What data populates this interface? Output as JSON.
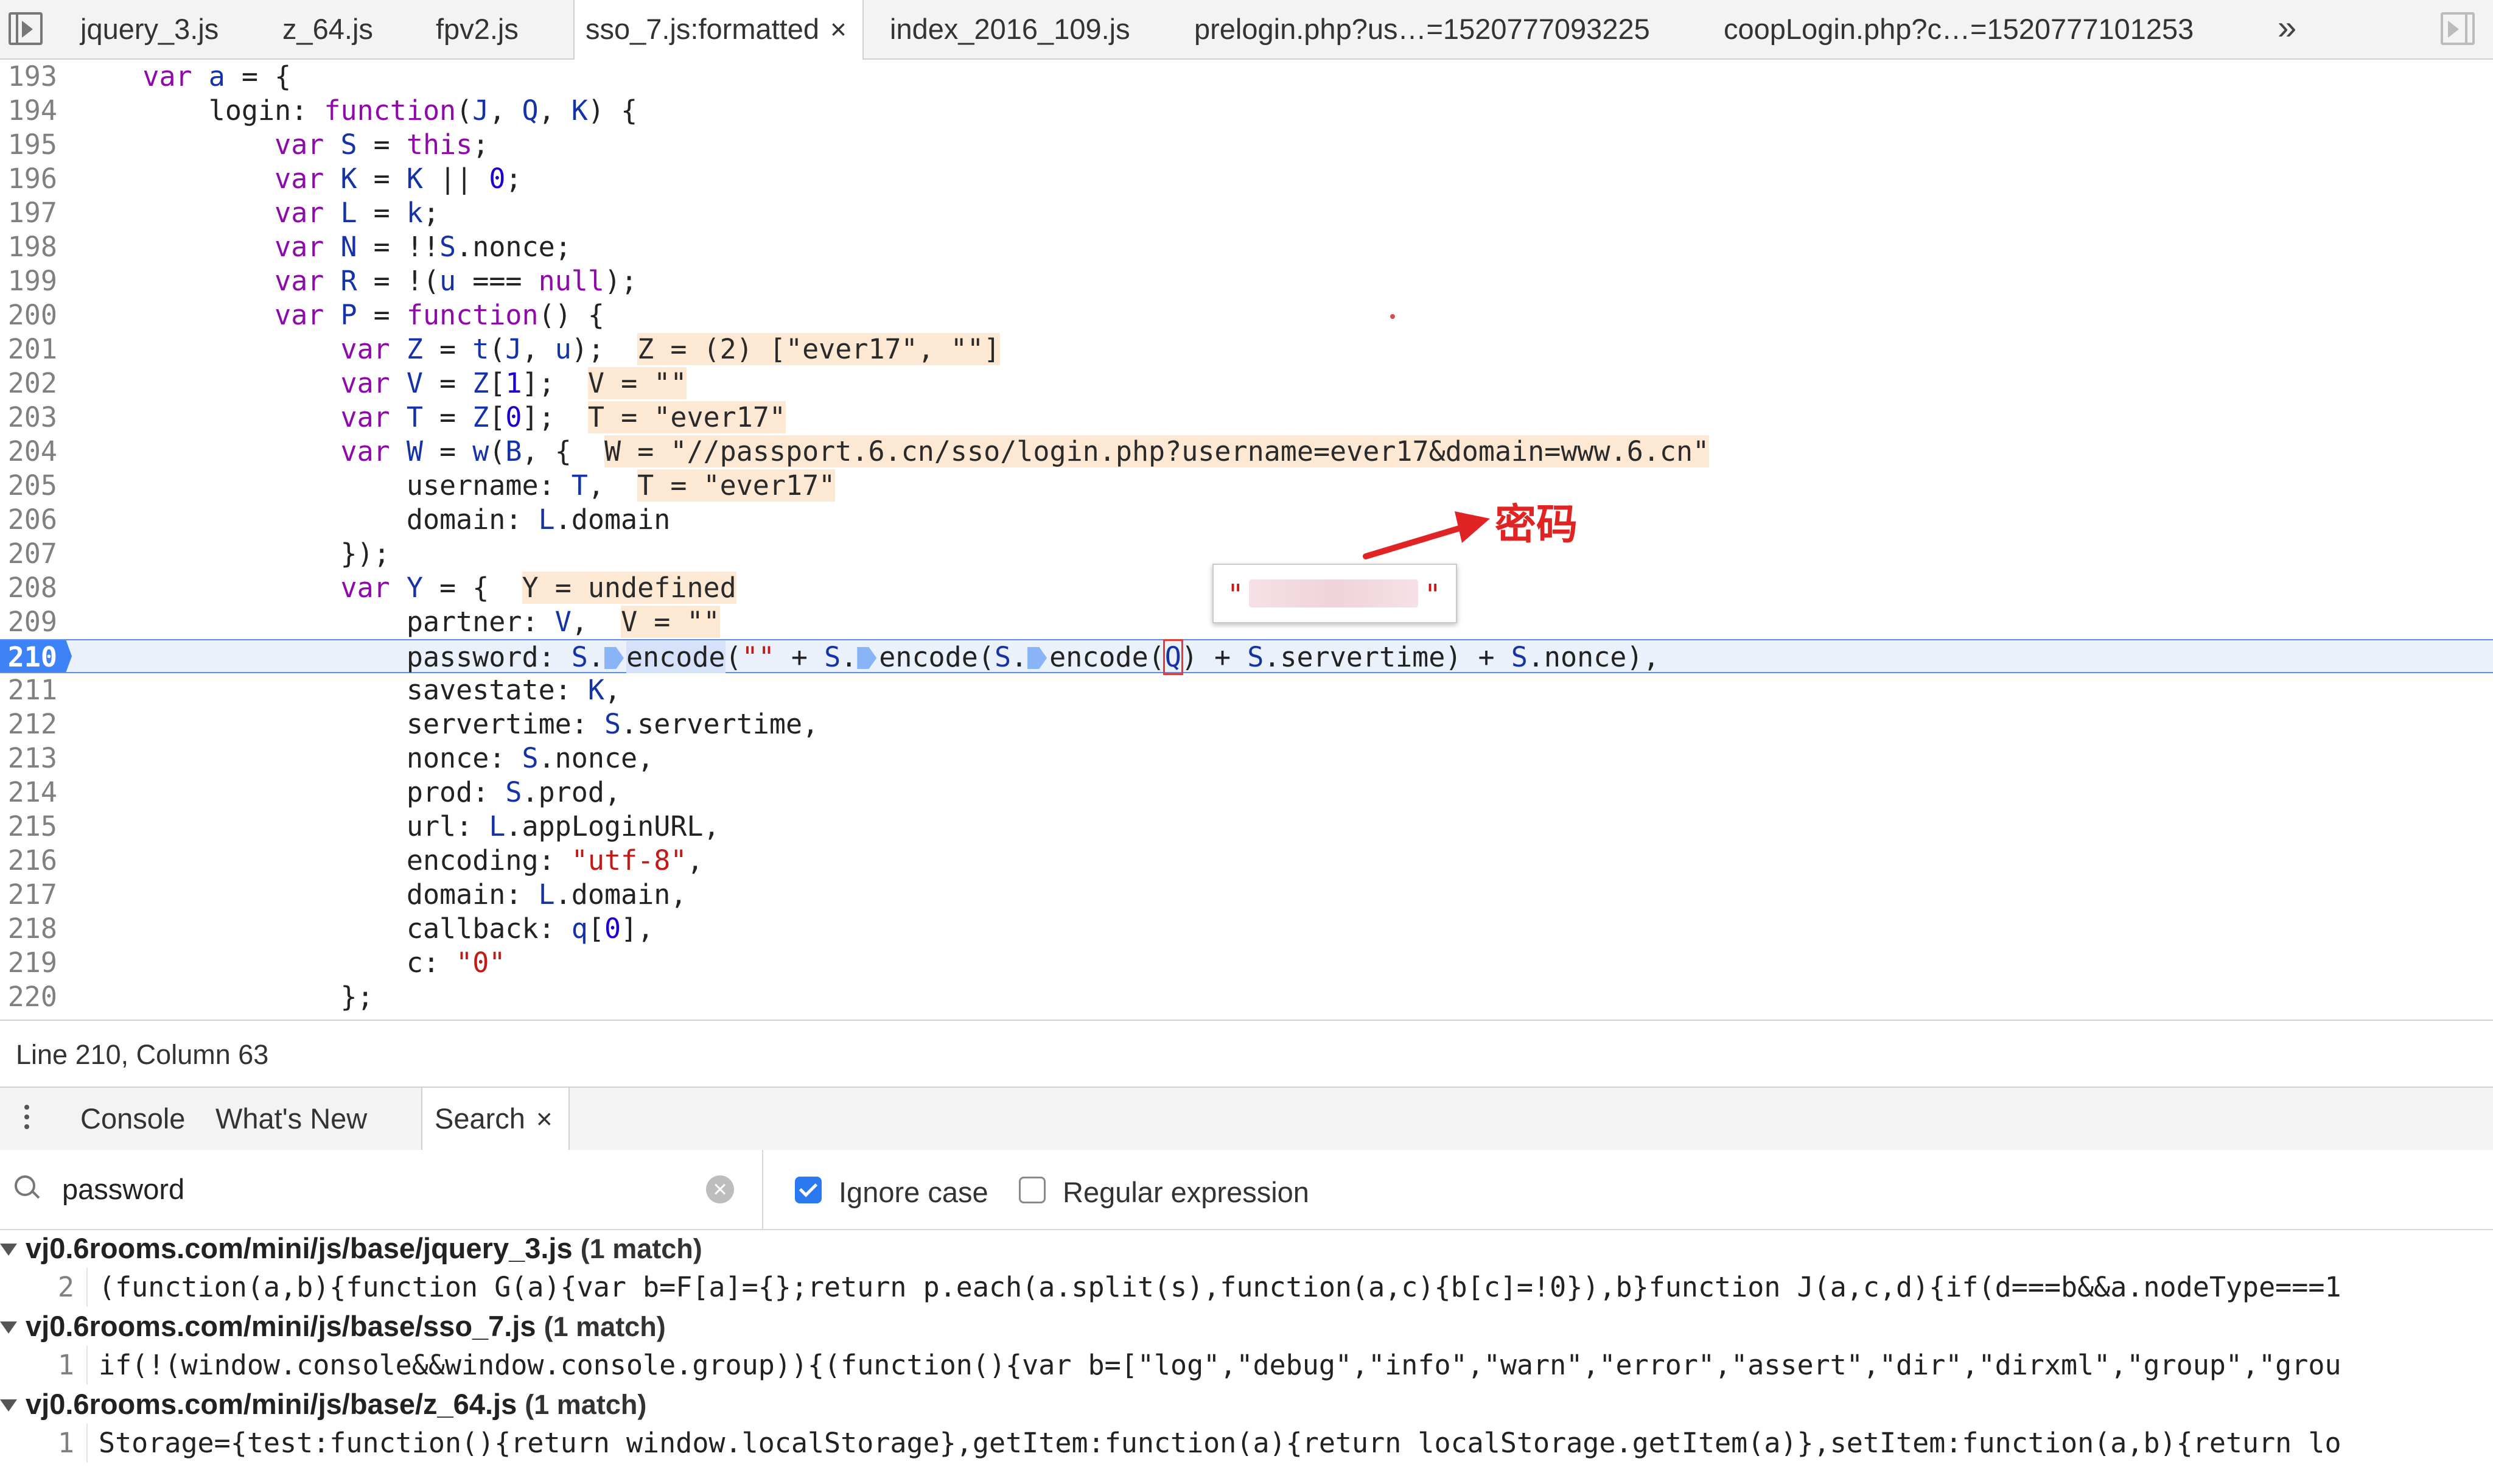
{
  "tabs": [
    {
      "label": "jquery_3.js"
    },
    {
      "label": "z_64.js"
    },
    {
      "label": "fpv2.js"
    },
    {
      "label": "sso_7.js:formatted",
      "close": "×"
    },
    {
      "label": "index_2016_109.js"
    },
    {
      "label": "prelogin.php?us…=1520777093225"
    },
    {
      "label": "coopLogin.php?c…=1520777101253"
    }
  ],
  "more_tabs": "»",
  "icons": {
    "panel_toggle_left": "sidebar-toggle-icon",
    "panel_toggle_right": "sidebar-toggle-icon",
    "search": "search-icon",
    "clear": "clear-icon"
  },
  "code_lines": [
    {
      "n": "193"
    },
    {
      "n": "194"
    },
    {
      "n": "195"
    },
    {
      "n": "196"
    },
    {
      "n": "197"
    },
    {
      "n": "198"
    },
    {
      "n": "199"
    },
    {
      "n": "200"
    },
    {
      "n": "201"
    },
    {
      "n": "202"
    },
    {
      "n": "203"
    },
    {
      "n": "204"
    },
    {
      "n": "205"
    },
    {
      "n": "206"
    },
    {
      "n": "207"
    },
    {
      "n": "208"
    },
    {
      "n": "209"
    },
    {
      "n": "210"
    },
    {
      "n": "211"
    },
    {
      "n": "212"
    },
    {
      "n": "213"
    },
    {
      "n": "214"
    },
    {
      "n": "215"
    },
    {
      "n": "216"
    },
    {
      "n": "217"
    },
    {
      "n": "218"
    },
    {
      "n": "219"
    },
    {
      "n": "220"
    }
  ],
  "inline_values": {
    "z": "Z = (2) [\"ever17\", \"\"]",
    "v": "V = \"\"",
    "t": "T = \"ever17\"",
    "w": "W = \"//passport.6.cn/sso/login.php?username=ever17&domain=www.6.cn\"",
    "t2": "T = \"ever17\"",
    "y": "Y = undefined",
    "v2": "V = \"\""
  },
  "tooltip": {
    "open_quote": "\"",
    "close_quote": "\""
  },
  "annotation": {
    "label": "密码",
    "color": "#e02424"
  },
  "status": {
    "position": "Line 210, Column 63"
  },
  "drawer": {
    "tabs": [
      {
        "label": "Console"
      },
      {
        "label": "What's New"
      },
      {
        "label": "Search",
        "close": "×"
      }
    ]
  },
  "search": {
    "query": "password",
    "clear": "×",
    "ignore_case_label": "Ignore case",
    "ignore_case_checked": true,
    "regex_label": "Regular expression",
    "regex_checked": false
  },
  "results": [
    {
      "file": "vj0.6rooms.com/mini/js/base/jquery_3.js",
      "count": "(1 match)",
      "line": "2",
      "text": "(function(a,b){function G(a){var b=F[a]={};return p.each(a.split(s),function(a,c){b[c]=!0}),b}function J(a,c,d){if(d===b&&a.nodeType===1"
    },
    {
      "file": "vj0.6rooms.com/mini/js/base/sso_7.js",
      "count": "(1 match)",
      "line": "1",
      "text": "if(!(window.console&&window.console.group)){(function(){var b=[\"log\",\"debug\",\"info\",\"warn\",\"error\",\"assert\",\"dir\",\"dirxml\",\"group\",\"grou"
    },
    {
      "file": "vj0.6rooms.com/mini/js/base/z_64.js",
      "count": "(1 match)",
      "line": "1",
      "text": "Storage={test:function(){return window.localStorage},getItem:function(a){return localStorage.getItem(a)},setItem:function(a,b){return lo"
    }
  ],
  "colors": {
    "accent": "#3e82f7",
    "keyword": "#8e0ba8",
    "string": "#c41a16",
    "variable": "#1533a6",
    "inline_value_bg": "#fde8d3"
  }
}
